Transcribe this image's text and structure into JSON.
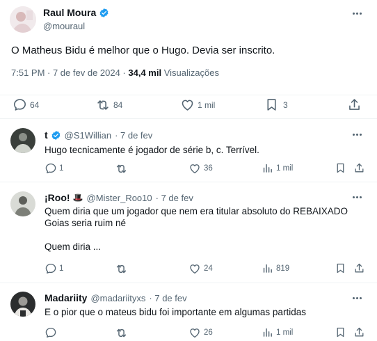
{
  "main_tweet": {
    "author_name": "Raul Moura",
    "author_handle": "@mouraul",
    "text": "O Matheus Bidu é melhor que o Hugo. Devia ser inscrito.",
    "time": "7:51 PM · 7 de fev de 2024 · ",
    "views_count": "34,4 mil",
    "views_label": " Visualizações",
    "stats": {
      "replies": "64",
      "retweets": "84",
      "likes": "1 mil",
      "bookmarks": "3"
    }
  },
  "replies": [
    {
      "name": "t",
      "verified": true,
      "handle": "@S1Willian",
      "time": "· 7 de fev",
      "lines": [
        "Hugo tecnicamente é jogador de série b, c. Terrível."
      ],
      "stats": {
        "replies": "1",
        "retweets": "",
        "likes": "36",
        "views": "1 mil"
      }
    },
    {
      "name": "¡Roo!",
      "badge_emoji": "🎩",
      "handle": "@Mister_Roo10",
      "time": "· 7 de fev",
      "lines": [
        "Quem diria que um jogador que nem era titular absoluto do REBAIXADO",
        "Goias seria ruim né",
        "",
        "Quem diria ..."
      ],
      "stats": {
        "replies": "1",
        "retweets": "",
        "likes": "24",
        "views": "819"
      }
    },
    {
      "name": "Madariity",
      "handle": "@madariityxs",
      "time": "· 7 de fev",
      "lines": [
        "E o pior que o mateus bidu foi importante em algumas partidas"
      ],
      "stats": {
        "replies": "",
        "retweets": "",
        "likes": "26",
        "views": "1 mil"
      }
    }
  ],
  "colors": {
    "verified": "#1d9bf0",
    "secondary_text": "#536471",
    "primary_text": "#0f1419",
    "divider": "#eff3f4"
  }
}
